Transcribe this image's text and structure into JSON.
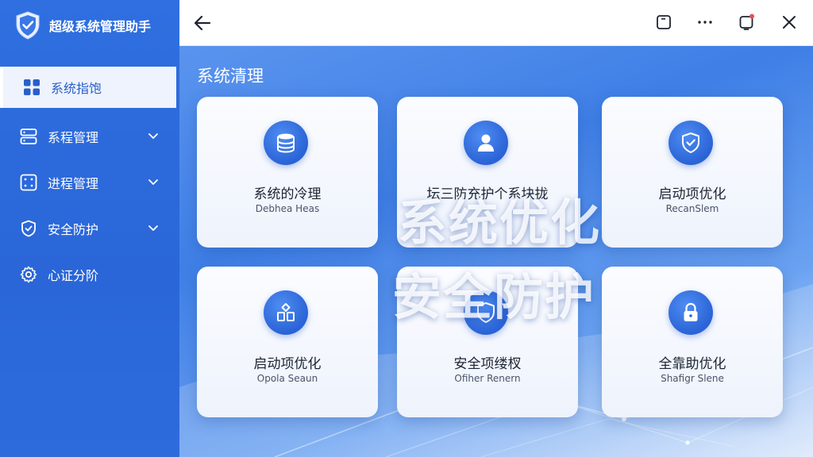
{
  "app": {
    "title": "超级系统管理助手"
  },
  "sidebar": {
    "items": [
      {
        "label": "系统指饱",
        "icon": "grid-icon",
        "active": true
      },
      {
        "label": "系程管理",
        "icon": "server-icon",
        "expandable": true
      },
      {
        "label": "进程管理",
        "icon": "dice-icon",
        "expandable": true
      },
      {
        "label": "安全防护",
        "icon": "shield-icon",
        "expandable": true
      },
      {
        "label": "心证分阶",
        "icon": "gear-icon"
      }
    ]
  },
  "header": {
    "icons": [
      "back-arrow-icon",
      "window-icon",
      "more-icon",
      "notification-icon",
      "close-icon"
    ]
  },
  "main": {
    "section_title": "系统清理",
    "cards": [
      {
        "title": "系统的冷理",
        "subtitle": "Debhea Heas",
        "icon": "database-icon"
      },
      {
        "title": "坛三防充护个系块拢",
        "subtitle": "",
        "icon": "user-icon"
      },
      {
        "title": "启动项优化",
        "subtitle": "RecanSlem",
        "icon": "shield-check-icon"
      },
      {
        "title": "启动项优化",
        "subtitle": "Opola Seaun",
        "icon": "blocks-icon"
      },
      {
        "title": "安全项缕杈",
        "subtitle": "Ofiher Renern",
        "icon": "shield-icon"
      },
      {
        "title": "全靠助优化",
        "subtitle": "Shafigr Slene",
        "icon": "lock-icon"
      }
    ],
    "overlay": {
      "line1": "系统优化",
      "line2": "安全防护"
    }
  },
  "colors": {
    "primary": "#2f6fe0",
    "accent": "#2a63d6",
    "card_bg": "#f6f8fe"
  }
}
